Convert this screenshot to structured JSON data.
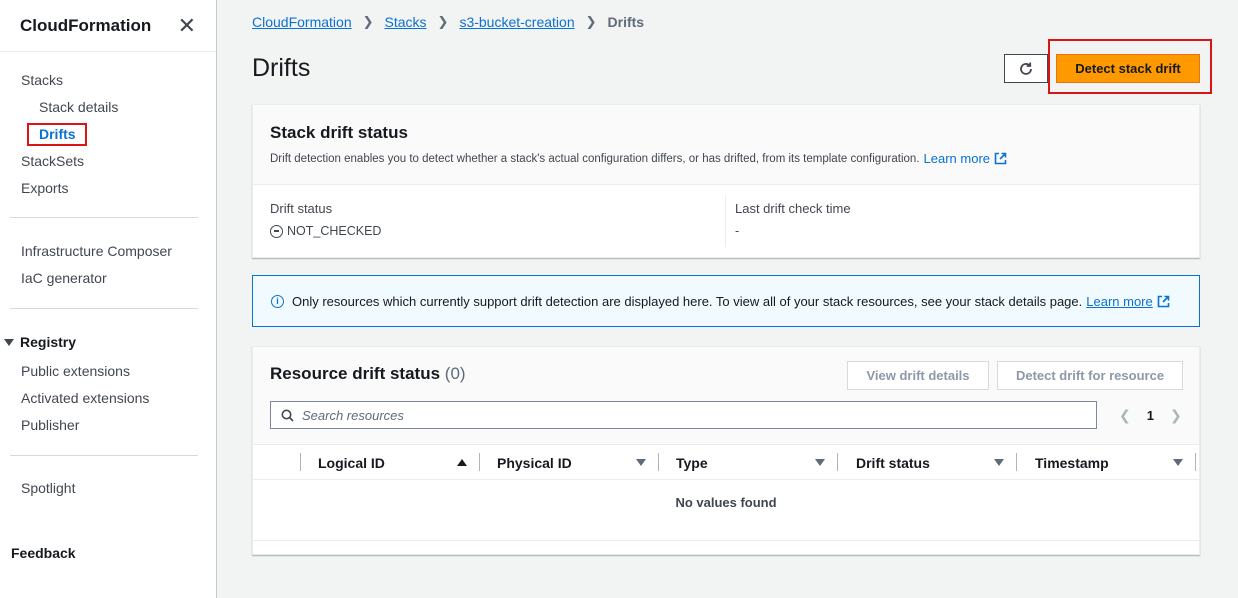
{
  "sidebar": {
    "title": "CloudFormation",
    "items": {
      "stacks": "Stacks",
      "stack_details": "Stack details",
      "drifts": "Drifts",
      "stacksets": "StackSets",
      "exports": "Exports",
      "infrastructure_composer": "Infrastructure Composer",
      "iac_generator": "IaC generator",
      "registry": "Registry",
      "public_extensions": "Public extensions",
      "activated_extensions": "Activated extensions",
      "publisher": "Publisher",
      "spotlight": "Spotlight",
      "feedback": "Feedback"
    }
  },
  "breadcrumb": [
    "CloudFormation",
    "Stacks",
    "s3-bucket-creation",
    "Drifts"
  ],
  "page": {
    "title": "Drifts",
    "detect_button": "Detect stack drift"
  },
  "drift_status_card": {
    "title": "Stack drift status",
    "description": "Drift detection enables you to detect whether a stack's actual configuration differs, or has drifted, from its template configuration.",
    "learn_more": "Learn more",
    "drift_status_label": "Drift status",
    "drift_status_value": "NOT_CHECKED",
    "last_check_label": "Last drift check time",
    "last_check_value": "-"
  },
  "info": {
    "text": "Only resources which currently support drift detection are displayed here. To view all of your stack resources, see your stack details page.",
    "learn_more": "Learn more"
  },
  "resource_card": {
    "title": "Resource drift status",
    "count": "(0)",
    "view_details_button": "View drift details",
    "detect_resource_button": "Detect drift for resource",
    "search_placeholder": "Search resources",
    "page": "1",
    "columns": [
      "Logical ID",
      "Physical ID",
      "Type",
      "Drift status",
      "Timestamp"
    ],
    "empty_text": "No values found"
  },
  "colors": {
    "accent": "#0972d3",
    "primary_button": "#ff9900",
    "highlight_outline": "#d91515"
  }
}
